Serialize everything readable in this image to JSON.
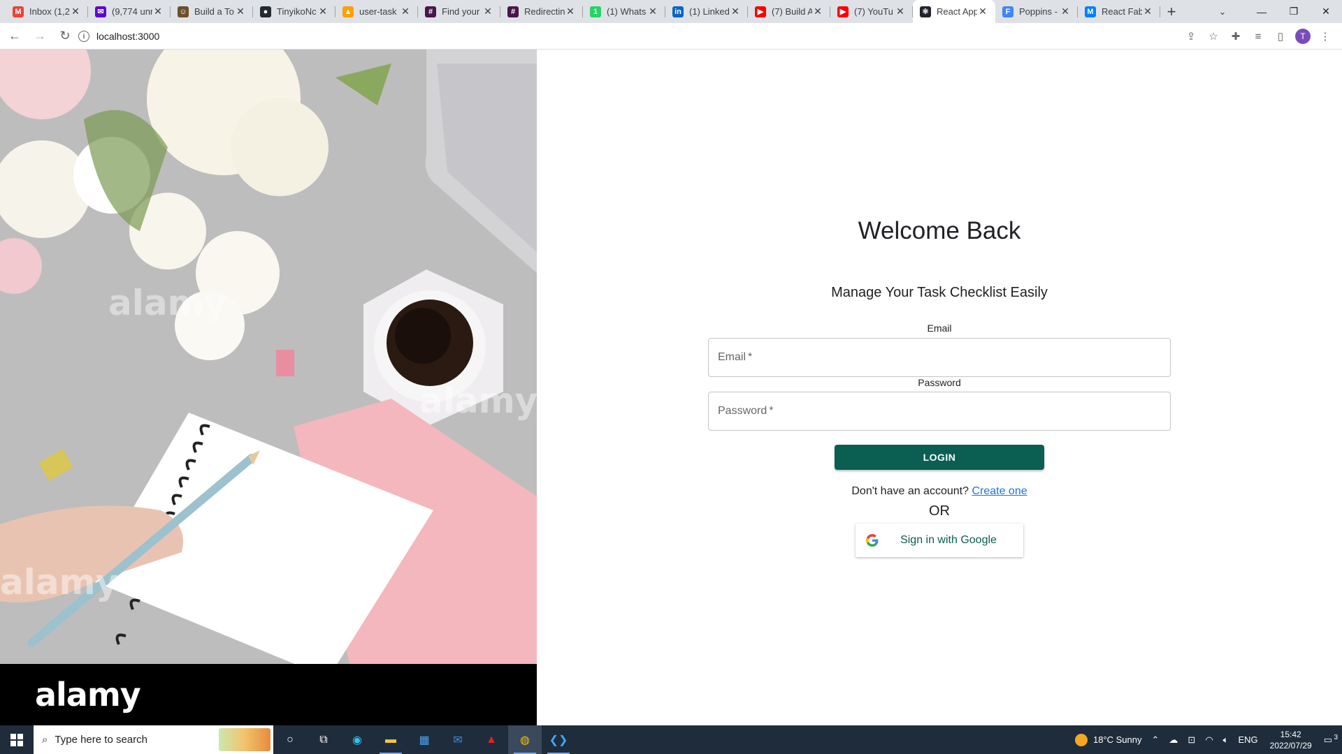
{
  "browser": {
    "tabs": [
      {
        "title": "Inbox (1,2",
        "favicon": "gmail-icon",
        "color": "#ea4335",
        "glyph": "M"
      },
      {
        "title": "(9,774 unr",
        "favicon": "yahoo-mail-icon",
        "color": "#6001d2",
        "glyph": "✉"
      },
      {
        "title": "Build a To",
        "favicon": "freecodecamp-icon",
        "color": "#6b4f2a",
        "glyph": "☺"
      },
      {
        "title": "TinyikoNc",
        "favicon": "github-icon",
        "color": "#24292f",
        "glyph": "●"
      },
      {
        "title": "user-task",
        "favicon": "firebase-icon",
        "color": "#ffa000",
        "glyph": "▲"
      },
      {
        "title": "Find your",
        "favicon": "slack-icon",
        "color": "#4a154b",
        "glyph": "#"
      },
      {
        "title": "Redirectin",
        "favicon": "slack-icon",
        "color": "#4a154b",
        "glyph": "#"
      },
      {
        "title": "(1) Whats",
        "favicon": "whatsapp-icon",
        "color": "#25d366",
        "glyph": "1"
      },
      {
        "title": "(1) Linked",
        "favicon": "linkedin-icon",
        "color": "#0a66c2",
        "glyph": "in"
      },
      {
        "title": "(7) Build A",
        "favicon": "youtube-icon",
        "color": "#ff0000",
        "glyph": "▶"
      },
      {
        "title": "(7) YouTu",
        "favicon": "youtube-icon",
        "color": "#ff0000",
        "glyph": "▶"
      },
      {
        "title": "React App",
        "favicon": "react-icon",
        "color": "#20232a",
        "glyph": "⚛",
        "active": true
      },
      {
        "title": "Poppins -",
        "favicon": "google-fonts-icon",
        "color": "#4285f4",
        "glyph": "F"
      },
      {
        "title": "React Fab",
        "favicon": "mui-icon",
        "color": "#007fff",
        "glyph": "M"
      }
    ],
    "url": "localhost:3000",
    "avatar_initial": "T"
  },
  "stock_photo": {
    "watermark_logo": "alamy"
  },
  "login": {
    "title": "Welcome Back",
    "subtitle": "Manage Your Task Checklist Easily",
    "email_label": "Email",
    "email_placeholder": "Email",
    "password_label": "Password",
    "password_placeholder": "Password",
    "required_marker": "*",
    "login_button": "LOGIN",
    "no_account_text": "Don't have an account?",
    "create_link": "Create one",
    "or_text": "OR",
    "google_button": "Sign in with Google",
    "brand_color": "#0a5e52"
  },
  "taskbar": {
    "search_placeholder": "Type here to search",
    "weather": "18°C  Sunny",
    "language": "ENG",
    "time": "15:42",
    "date": "2022/07/29",
    "notification_count": "3"
  }
}
